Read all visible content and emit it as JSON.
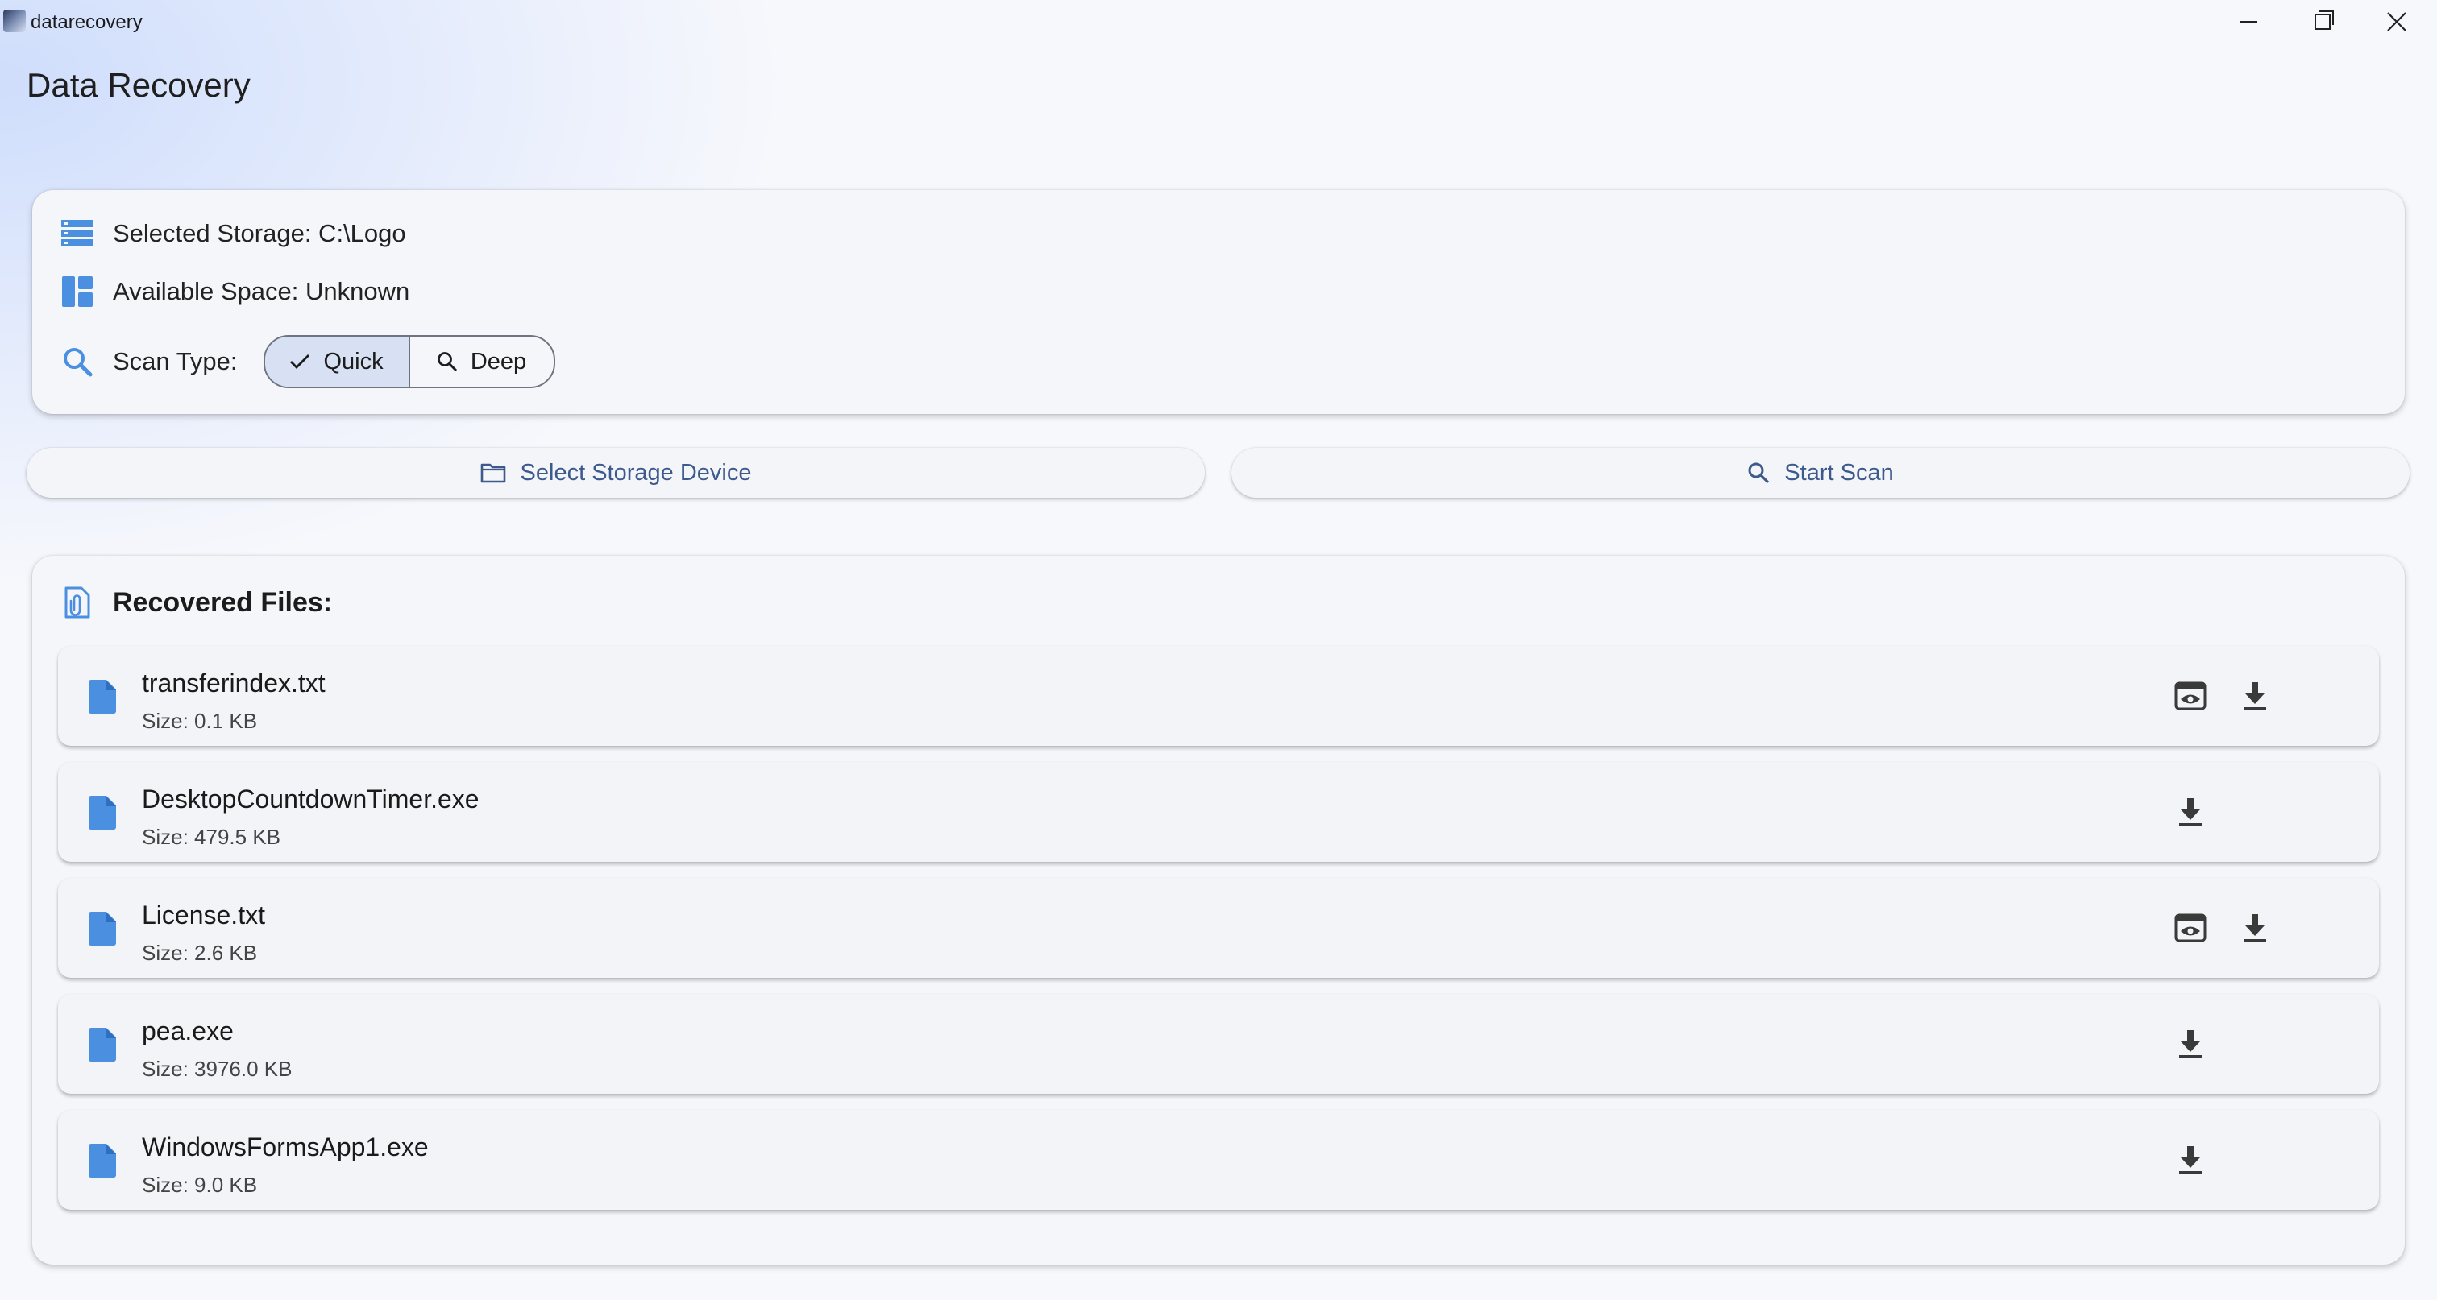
{
  "window": {
    "title": "datarecovery"
  },
  "page": {
    "title": "Data Recovery"
  },
  "info": {
    "selected_storage": "Selected Storage: C:\\Logo",
    "available_space": "Available Space: Unknown",
    "scan_type_label": "Scan Type:",
    "scan_options": [
      "Quick",
      "Deep"
    ],
    "selected_scan": "Quick"
  },
  "actions": {
    "select_storage": "Select Storage Device",
    "start_scan": "Start Scan"
  },
  "recovered": {
    "title": "Recovered Files:",
    "files": [
      {
        "name": "transferindex.txt",
        "size": "Size: 0.1 KB",
        "preview": true
      },
      {
        "name": "DesktopCountdownTimer.exe",
        "size": "Size: 479.5 KB",
        "preview": false
      },
      {
        "name": "License.txt",
        "size": "Size: 2.6 KB",
        "preview": true
      },
      {
        "name": "pea.exe",
        "size": "Size: 3976.0 KB",
        "preview": false
      },
      {
        "name": "WindowsFormsApp1.exe",
        "size": "Size: 9.0 KB",
        "preview": false
      }
    ]
  },
  "colors": {
    "accent": "#4a8fe0",
    "button_text": "#3d5a8c",
    "selected_segment": "#d8e1f3"
  },
  "icons": {
    "storage": "storage-icon",
    "space": "dashboard-icon",
    "scan": "search-icon",
    "files_header": "attachment-file-icon",
    "file": "file-icon",
    "preview": "preview-icon",
    "download": "download-icon",
    "folder": "folder-icon"
  }
}
